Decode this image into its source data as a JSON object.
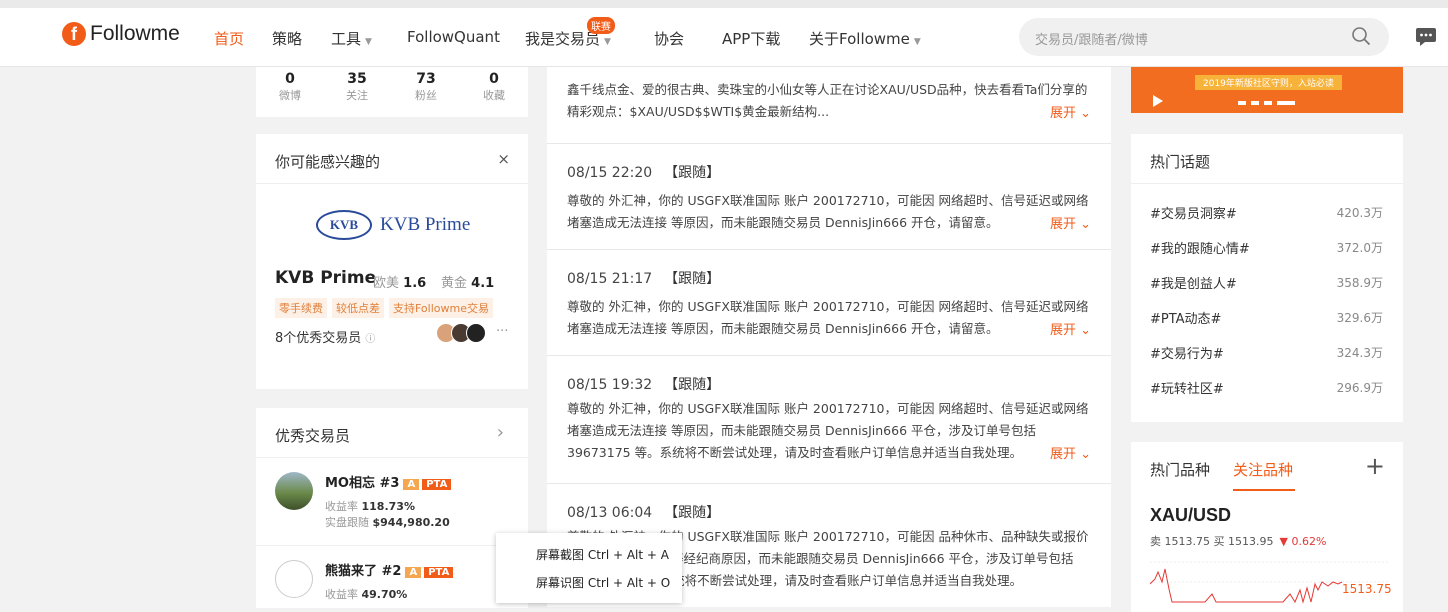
{
  "nav": {
    "logo_text": "Followme",
    "items": [
      {
        "label": "首页",
        "active": true
      },
      {
        "label": "策略"
      },
      {
        "label": "工具"
      },
      {
        "label": "FollowQuant"
      },
      {
        "label": "我是交易员"
      },
      {
        "label": "协会"
      },
      {
        "label": "APP下载"
      },
      {
        "label": "关于Followme"
      }
    ],
    "badge_lian": "联赛",
    "search_placeholder": "交易员/跟随者/微博"
  },
  "profile_stats": [
    {
      "value": "0",
      "label": "微博"
    },
    {
      "value": "35",
      "label": "关注"
    },
    {
      "value": "73",
      "label": "粉丝"
    },
    {
      "value": "0",
      "label": "收藏"
    }
  ],
  "interest": {
    "title": "你可能感兴趣的",
    "close": "×",
    "logo_mark": "KVB",
    "logo_text": "KVB Prime",
    "name": "KVB Prime",
    "stat1_label": "欧美",
    "stat1_value": "1.6",
    "stat2_label": "黄金",
    "stat2_value": "4.1",
    "tags": [
      "零手续费",
      "较低点差",
      "支持Followme交易"
    ],
    "traders_text": "8个优秀交易员",
    "more": "···"
  },
  "best_traders": {
    "title": "优秀交易员",
    "traders": [
      {
        "name": "MO相忘 #3",
        "level": "A",
        "badge": "PTA",
        "return_label": "收益率",
        "return": "118.73%",
        "follow_label": "实盘跟随",
        "follow": "$944,980.20"
      },
      {
        "name": "熊猫来了 #2",
        "level": "A",
        "badge": "PTA",
        "return_label": "收益率",
        "return": "49.70%"
      }
    ]
  },
  "feed": {
    "expand": "展开",
    "posts": [
      {
        "head": "",
        "type": "",
        "body": "鑫千线点金、爱的很古典、卖珠宝的小仙女等人正在讨论XAU/USD品种，快去看看Ta们分享的精彩观点：$XAU/USD$$WTI$黄金最新结构..."
      },
      {
        "head": "08/15 22:20",
        "type": "【跟随】",
        "body": "尊敬的 外汇神，你的 USGFX联准国际 账户 200172710，可能因 网络超时、信号延迟或网络堵塞造成无法连接 等原因，而未能跟随交易员 DennisJin666 开仓，请留意。"
      },
      {
        "head": "08/15 21:17",
        "type": "【跟随】",
        "body": "尊敬的 外汇神，你的 USGFX联准国际 账户 200172710，可能因 网络超时、信号延迟或网络堵塞造成无法连接 等原因，而未能跟随交易员 DennisJin666 开仓，请留意。"
      },
      {
        "head": "08/15 19:32",
        "type": "【跟随】",
        "body": "尊敬的 外汇神，你的 USGFX联准国际 账户 200172710，可能因 网络超时、信号延迟或网络堵塞造成无法连接 等原因，而未能跟随交易员 DennisJin666 平仓，涉及订单号包括 39673175 等。系统将不断尝试处理，请及时查看账户订单信息并适当自我处理。"
      },
      {
        "head": "08/13 06:04",
        "type": "【跟随】",
        "body": "尊敬的 外汇神，你的 USGFX联准国际 账户 200172710，可能因 品种休市、品种缺失或报价 数规则或网络阻塞 等经纪商原因，而未能跟随交易员 DennisJin666 平仓，涉及订单号包括 39519782 等。系统将不断尝试处理，请及时查看账户订单信息并适当自我处理。"
      }
    ]
  },
  "context_menu": {
    "items": [
      "屏幕截图 Ctrl + Alt + A",
      "屏幕识图 Ctrl + Alt + O"
    ]
  },
  "banner": {
    "text": "2019年新版社区守则，入站必读"
  },
  "hot_topics": {
    "title": "热门话题",
    "items": [
      {
        "name": "#交易员洞察#",
        "count": "420.3万"
      },
      {
        "name": "#我的跟随心情#",
        "count": "372.0万"
      },
      {
        "name": "#我是创益人#",
        "count": "358.9万"
      },
      {
        "name": "#PTA动态#",
        "count": "329.6万"
      },
      {
        "name": "#交易行为#",
        "count": "324.3万"
      },
      {
        "name": "#玩转社区#",
        "count": "296.9万"
      }
    ]
  },
  "instruments": {
    "tab_hot": "热门品种",
    "tab_follow": "关注品种",
    "plus": "+",
    "symbol": "XAU/USD",
    "sell_label": "卖",
    "sell": "1513.75",
    "buy_label": "买",
    "buy": "1513.95",
    "change": "▼ 0.62%",
    "last_price": "1513.75"
  },
  "colors": {
    "accent": "#f25c19",
    "brand_blue": "#2a4a9a"
  }
}
